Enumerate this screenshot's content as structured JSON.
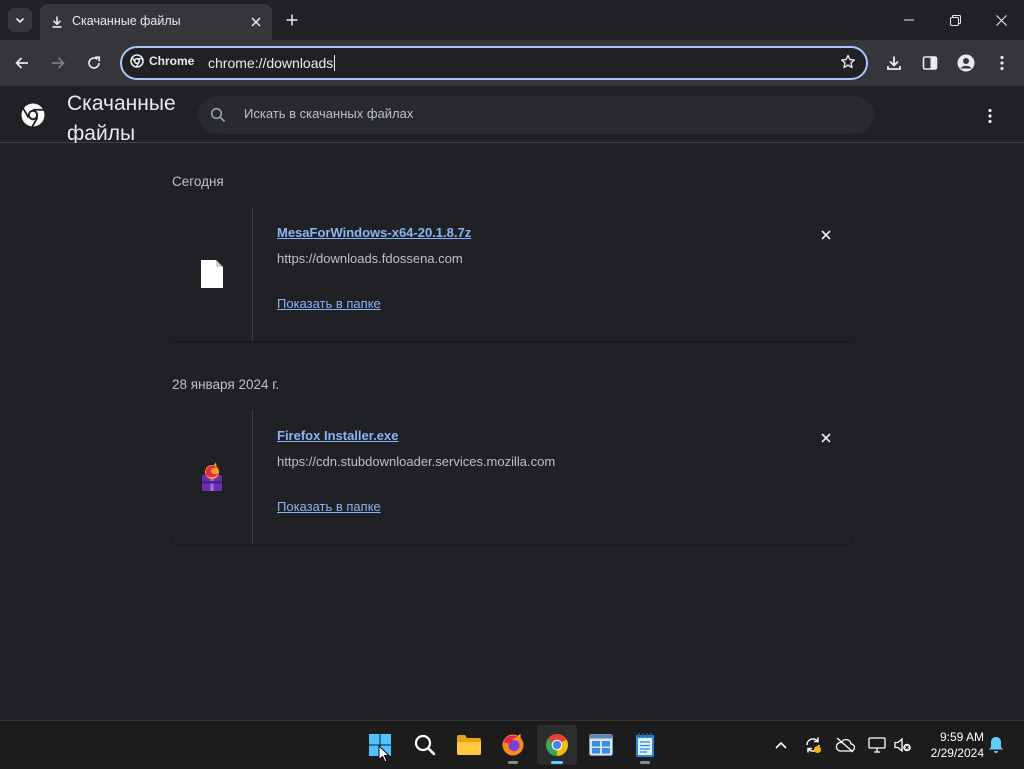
{
  "tab": {
    "title": "Скачанные файлы"
  },
  "omnibox": {
    "chip_label": "Chrome",
    "url": "chrome://downloads"
  },
  "header": {
    "title": "Скачанные файлы",
    "search_placeholder": "Искать в скачанных файлах"
  },
  "groups": [
    {
      "date": "Сегодня",
      "item": {
        "file_name": "MesaForWindows-x64-20.1.8.7z",
        "source": "https://downloads.fdossena.com",
        "action": "Показать в папке",
        "icon": "file-icon"
      }
    },
    {
      "date": "28 января 2024 г.",
      "item": {
        "file_name": "Firefox Installer.exe",
        "source": "https://cdn.stubdownloader.services.mozilla.com",
        "action": "Показать в папке",
        "icon": "firefox-installer-icon"
      }
    }
  ],
  "taskbar": {
    "time": "9:59 AM",
    "date": "2/29/2024",
    "apps": [
      "start-icon",
      "search-icon",
      "file-explorer-icon",
      "firefox-icon",
      "chrome-icon",
      "windows-sandbox-icon",
      "notepad-icon"
    ]
  },
  "colors": {
    "background": "#202124",
    "toolbar": "#35363a",
    "link": "#8ab4f8",
    "focus_ring": "#a8c7fa",
    "taskbar": "#1c1c1c"
  }
}
